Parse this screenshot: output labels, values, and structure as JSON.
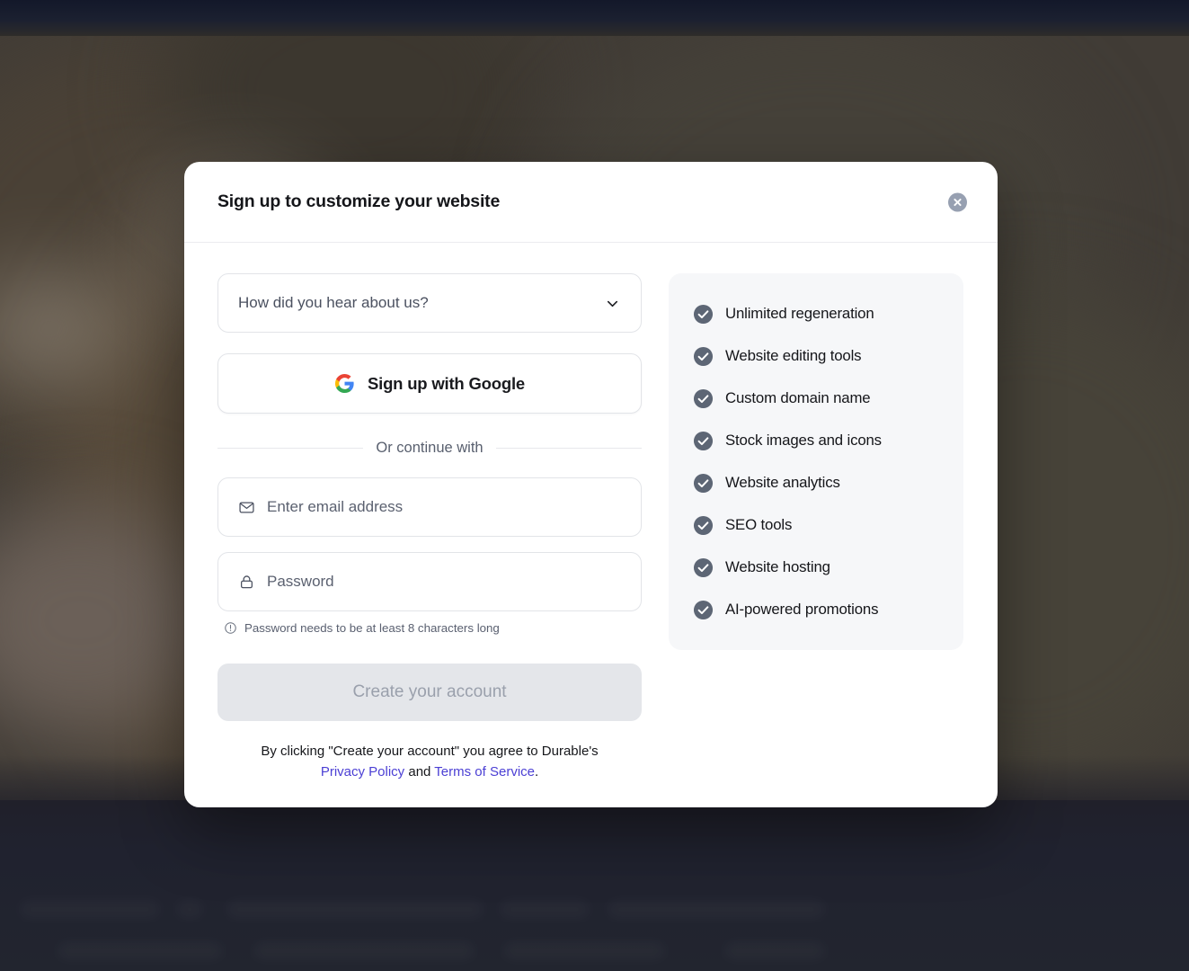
{
  "modal": {
    "title": "Sign up to customize your website",
    "close_icon": "close-icon",
    "close_label": "Close"
  },
  "form": {
    "referral_select": {
      "label": "How did you hear about us?",
      "chevron_icon": "chevron-down-icon"
    },
    "google_button": {
      "label": "Sign up with Google",
      "icon": "google-logo-icon"
    },
    "divider_label": "Or continue with",
    "email": {
      "placeholder": "Enter email address",
      "value": "",
      "icon": "mail-icon"
    },
    "password": {
      "placeholder": "Password",
      "value": "",
      "icon": "lock-icon"
    },
    "password_hint": {
      "text": "Password needs to be at least 8 characters long",
      "icon": "alert-circle-icon"
    },
    "submit_button": {
      "label": "Create your account",
      "disabled": true
    },
    "legal": {
      "prefix": "By clicking \"Create your account\" you agree to Durable's",
      "privacy_link": "Privacy Policy",
      "conjunction": "and",
      "terms_link": "Terms of Service",
      "suffix": "."
    }
  },
  "benefits": {
    "check_icon": "check-circle-icon",
    "items": [
      {
        "label": "Unlimited regeneration"
      },
      {
        "label": "Website editing tools"
      },
      {
        "label": "Custom domain name"
      },
      {
        "label": "Stock images and icons"
      },
      {
        "label": "Website analytics"
      },
      {
        "label": "SEO tools"
      },
      {
        "label": "Website hosting"
      },
      {
        "label": "AI-powered promotions"
      }
    ]
  },
  "colors": {
    "link": "#4b3fd4",
    "check_circle": "#5d6675",
    "panel_bg": "#f6f7f9",
    "disabled_button_bg": "#e4e6ea",
    "disabled_button_text": "#9aa0ac",
    "close_button_bg": "#97a0b1"
  }
}
